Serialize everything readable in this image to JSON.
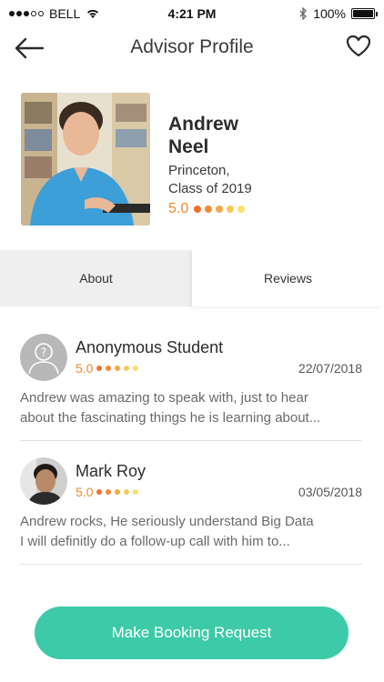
{
  "status_bar": {
    "carrier": "BELL",
    "time": "4:21 PM",
    "battery": "100%"
  },
  "header": {
    "title": "Advisor Profile",
    "back_icon": "back-arrow-icon",
    "favorite_icon": "heart-icon"
  },
  "profile": {
    "first_name": "Andrew",
    "last_name": "Neel",
    "school": "Princeton,",
    "class_year": "Class of 2019",
    "rating": "5.0"
  },
  "tabs": [
    {
      "label": "About",
      "active": false
    },
    {
      "label": "Reviews",
      "active": true
    }
  ],
  "reviews": [
    {
      "name": "Anonymous Student",
      "rating": "5.0",
      "date": "22/07/2018",
      "text_line1": "Andrew was amazing to speak with, just to hear",
      "text_line2": "about the fascinating things he is learning about..."
    },
    {
      "name": "Mark Roy",
      "rating": "5.0",
      "date": "03/05/2018",
      "text_line1": "Andrew rocks, He seriously understand Big Data",
      "text_line2": "I will definitly do a follow-up call with him to..."
    }
  ],
  "cta": {
    "label": "Make Booking Request"
  },
  "colors": {
    "accent": "#3ccaa8",
    "rating_orange": "#f08a2c",
    "rating_dots": [
      "#f0702a",
      "#f28a34",
      "#f5a843",
      "#f7c957",
      "#f8e06c"
    ]
  }
}
